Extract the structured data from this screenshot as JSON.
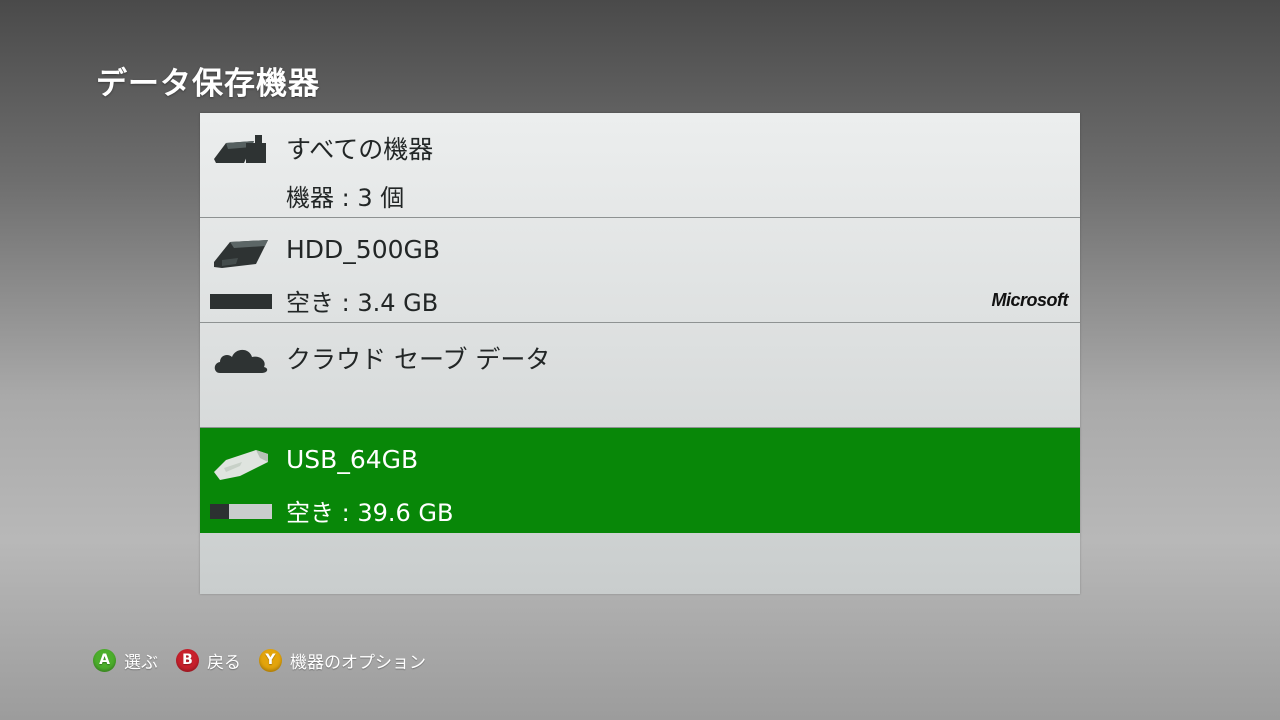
{
  "page_title": "データ保存機器",
  "colors": {
    "selected_row": "#088708",
    "button_a": "#4cae2c",
    "button_b": "#c8202c",
    "button_y": "#e3a40c"
  },
  "devices": [
    {
      "icon": "all-devices-icon",
      "title": "すべての機器",
      "subtitle": "機器 : 3 個"
    },
    {
      "icon": "hard-drive-icon",
      "title": "HDD_500GB",
      "subtitle": "空き : 3.4 GB",
      "used_fraction": 1.0,
      "brand": "Microsoft"
    },
    {
      "icon": "cloud-icon",
      "title": "クラウド セーブ データ",
      "subtitle": ""
    },
    {
      "icon": "usb-drive-icon",
      "title": "USB_64GB",
      "subtitle": "空き : 39.6 GB",
      "used_fraction": 0.3,
      "selected": true
    }
  ],
  "footer": {
    "hints": [
      {
        "button": "A",
        "label": "選ぶ"
      },
      {
        "button": "B",
        "label": "戻る"
      },
      {
        "button": "Y",
        "label": "機器のオプション"
      }
    ]
  }
}
